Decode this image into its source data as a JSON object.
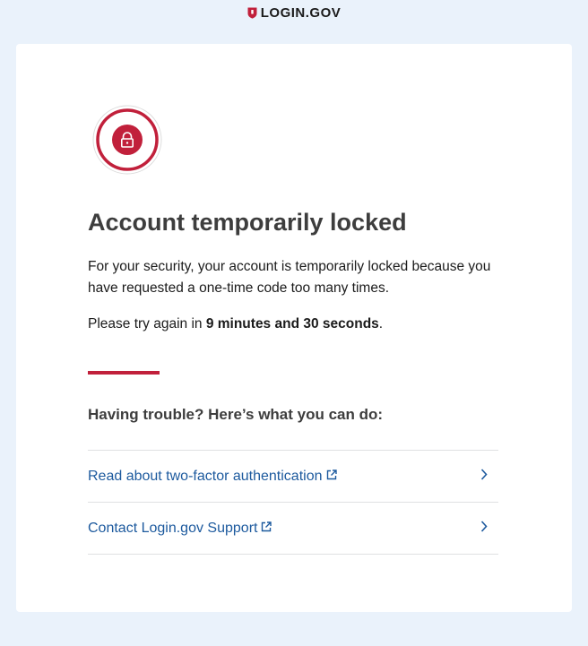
{
  "header": {
    "logo_text": "LOGIN.GOV"
  },
  "main": {
    "title": "Account temporarily locked",
    "body_text": "For your security, your account is temporarily locked because you have requested a one-time code too many times.",
    "retry_prefix": "Please try again in ",
    "retry_time": "9 minutes and 30 seconds",
    "retry_suffix": "."
  },
  "trouble": {
    "heading": "Having trouble? Here’s what you can do:",
    "links": [
      {
        "label": "Read about two-factor authentication"
      },
      {
        "label": "Contact Login.gov Support"
      }
    ]
  },
  "colors": {
    "accent": "#c1203b",
    "link": "#1d5a9e",
    "page_background": "#eaf2fb"
  },
  "icons": {
    "logo": "shield-icon",
    "status": "lock-icon",
    "external": "external-link-icon",
    "chevron": "chevron-right-icon"
  }
}
